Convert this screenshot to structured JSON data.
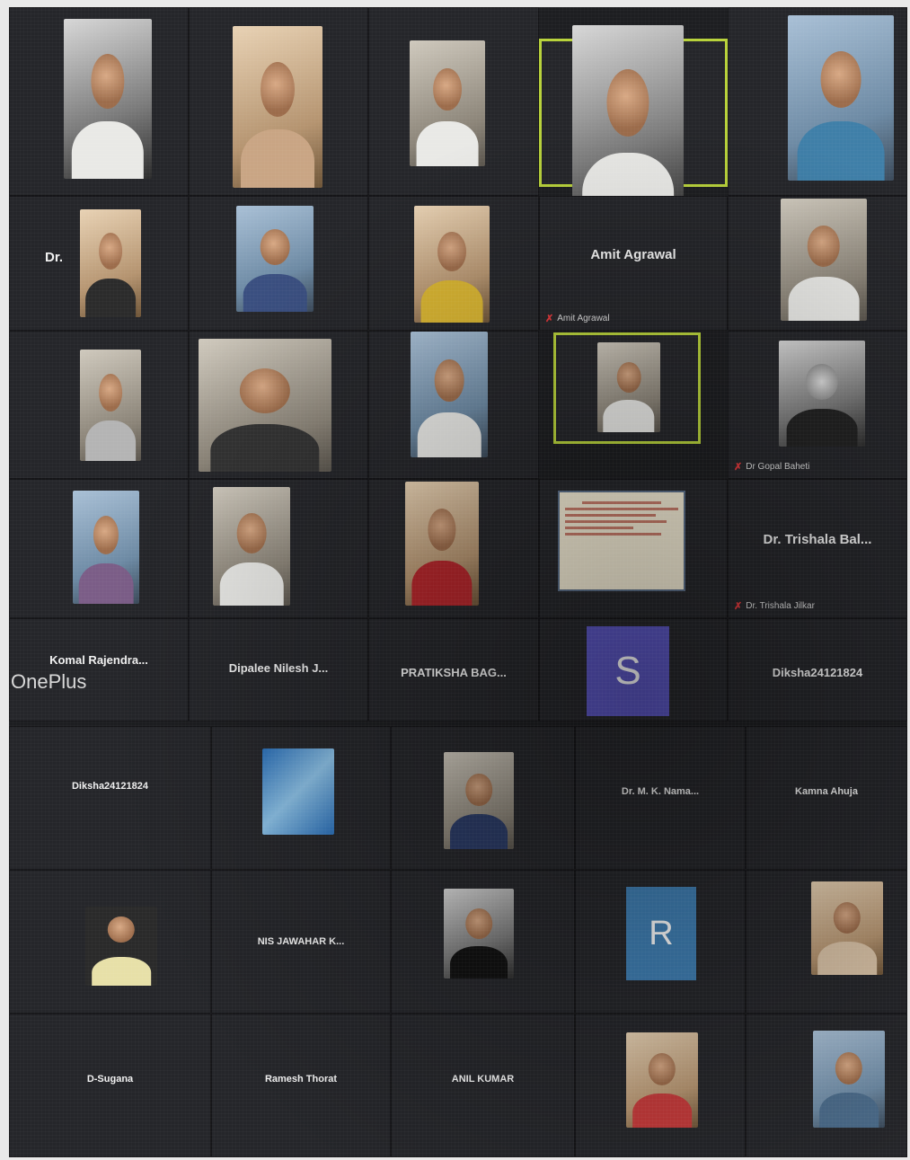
{
  "watermark": "OnePlus",
  "colors": {
    "active_speaker_border": "#b8d23a",
    "mic_muted": "#e5383b",
    "avatar_s": "#5a55c2",
    "avatar_r": "#3f7fb4"
  },
  "icons": {
    "mic_muted": "mic-muted-icon"
  },
  "participants_top": [
    {
      "id": "p1",
      "label": "",
      "active": false
    },
    {
      "id": "p2",
      "label": "",
      "active": false
    },
    {
      "id": "p3",
      "label": "",
      "active": false
    },
    {
      "id": "p4",
      "label": "",
      "active": true
    },
    {
      "id": "p5",
      "label": "",
      "active": false
    },
    {
      "id": "p6",
      "center": "Dr.",
      "active": false
    },
    {
      "id": "p7",
      "active": false
    },
    {
      "id": "p8",
      "active": false
    },
    {
      "id": "p9",
      "center": "Amit Agrawal",
      "label": "Amit Agrawal",
      "active": false
    },
    {
      "id": "p10",
      "active": false
    },
    {
      "id": "p11",
      "active": false
    },
    {
      "id": "p12",
      "active": false
    },
    {
      "id": "p13",
      "active": false
    },
    {
      "id": "p14",
      "active": true
    },
    {
      "id": "p15",
      "label": "Dr Gopal Baheti",
      "active": false
    },
    {
      "id": "p16",
      "active": false
    },
    {
      "id": "p17",
      "active": false
    },
    {
      "id": "p18",
      "active": false
    },
    {
      "id": "p19",
      "active": false
    },
    {
      "id": "p20",
      "center": "Dr. Trishala Bal...",
      "label": "Dr. Trishala Jilkar",
      "active": false
    }
  ],
  "participants_mid": [
    {
      "id": "m1",
      "center": "Komal Rajendra..."
    },
    {
      "id": "m2",
      "center": "Dipalee Nilesh J..."
    },
    {
      "id": "m3",
      "center": "PRATIKSHA BAG..."
    },
    {
      "id": "m4",
      "avatar": "S"
    },
    {
      "id": "m5",
      "center": "Diksha24121824"
    }
  ],
  "participants_bottom": [
    {
      "id": "b1",
      "center": "Diksha24121824"
    },
    {
      "id": "b2"
    },
    {
      "id": "b3"
    },
    {
      "id": "b4",
      "center": "Dr. M. K. Nama..."
    },
    {
      "id": "b5",
      "center": "Kamna Ahuja"
    },
    {
      "id": "b6"
    },
    {
      "id": "b7",
      "center": "NIS JAWAHAR K..."
    },
    {
      "id": "b8"
    },
    {
      "id": "b9",
      "avatar": "R"
    },
    {
      "id": "b10"
    },
    {
      "id": "b11",
      "center": "D-Sugana"
    },
    {
      "id": "b12",
      "center": "Ramesh Thorat"
    },
    {
      "id": "b13",
      "center": "ANIL KUMAR"
    },
    {
      "id": "b14"
    },
    {
      "id": "b15"
    }
  ]
}
